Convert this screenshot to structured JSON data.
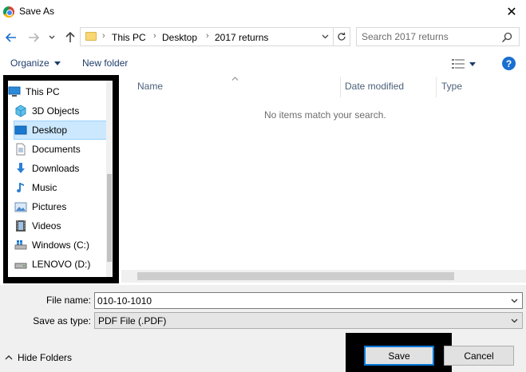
{
  "window": {
    "title": "Save As",
    "close_glyph": "✕"
  },
  "address": {
    "crumbs": [
      "This PC",
      "Desktop",
      "2017 returns"
    ],
    "separator": "›"
  },
  "search": {
    "placeholder": "Search 2017 returns"
  },
  "toolbar": {
    "organize_label": "Organize",
    "new_folder_label": "New folder",
    "help_label": "?"
  },
  "nav_pane": {
    "items": [
      {
        "label": "This PC",
        "icon": "this-pc-icon"
      },
      {
        "label": "3D Objects",
        "icon": "3d-objects-icon"
      },
      {
        "label": "Desktop",
        "icon": "desktop-icon",
        "selected": true
      },
      {
        "label": "Documents",
        "icon": "documents-icon"
      },
      {
        "label": "Downloads",
        "icon": "downloads-icon"
      },
      {
        "label": "Music",
        "icon": "music-icon"
      },
      {
        "label": "Pictures",
        "icon": "pictures-icon"
      },
      {
        "label": "Videos",
        "icon": "videos-icon"
      },
      {
        "label": "Windows (C:)",
        "icon": "windows-drive-icon"
      },
      {
        "label": "LENOVO (D:)",
        "icon": "lenovo-drive-icon"
      }
    ]
  },
  "file_list": {
    "columns": [
      "Name",
      "Date modified",
      "Type"
    ],
    "empty_message": "No items match your search."
  },
  "form": {
    "file_name_label": "File name:",
    "file_name_value": "010-10-1010",
    "save_as_type_label": "Save as type:",
    "save_as_type_value": "PDF File (.PDF)"
  },
  "footer": {
    "hide_folders_label": "Hide Folders",
    "save_label": "Save",
    "cancel_label": "Cancel"
  },
  "colors": {
    "accent": "#0078d7",
    "selection_bg": "#cce8ff",
    "link_text": "#1e3d6b"
  }
}
